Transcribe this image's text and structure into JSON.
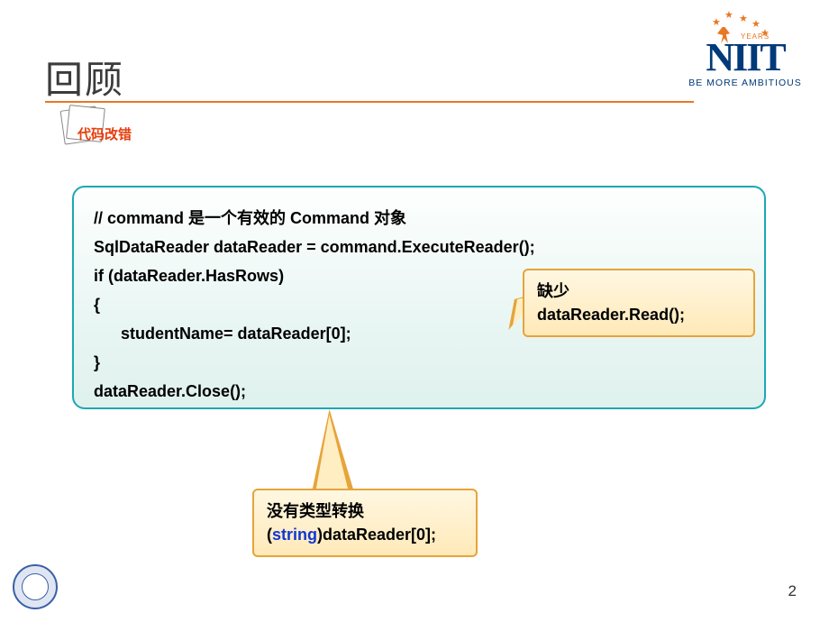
{
  "header": {
    "title": "回顾",
    "badge": "代码改错"
  },
  "logo": {
    "brand": "NIIT",
    "tagline": "BE MORE AMBITIOUS",
    "years": "YEARS"
  },
  "code": {
    "l1": "// command 是一个有效的 Command 对象",
    "l2": "SqlDataReader dataReader = command.ExecuteReader();",
    "l3": "if (dataReader.HasRows)",
    "l4": "{",
    "l5": "      studentName= dataReader[0];",
    "l6": "}",
    "l7": "dataReader.Close();"
  },
  "callouts": {
    "c1_l1": "缺少",
    "c1_l2": "dataReader.Read();",
    "c2_l1": "没有类型转换",
    "c2_l2a": "(",
    "c2_keyword": "string",
    "c2_l2b": ")dataReader[0];"
  },
  "footer": {
    "page": "2"
  }
}
